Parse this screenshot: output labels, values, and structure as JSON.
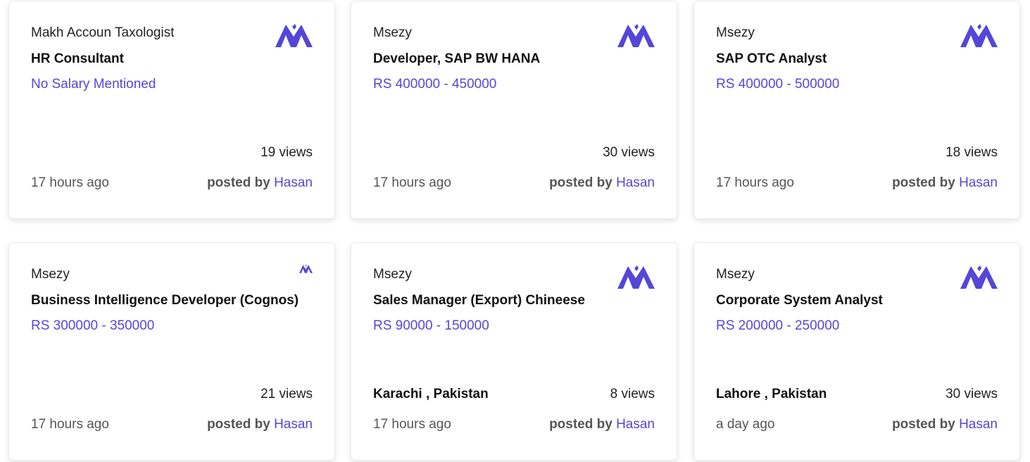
{
  "brand_color": "#5546d8",
  "logo_icon": "mountain-m-logo-icon",
  "cards": [
    {
      "company": "Makh Accoun Taxologist",
      "title": "HR Consultant",
      "salary": "No Salary Mentioned",
      "location": "",
      "views": "19 views",
      "time": "17 hours ago",
      "posted_label": "posted by",
      "poster": "Hasan"
    },
    {
      "company": "Msezy",
      "title": "Developer, SAP BW HANA",
      "salary": "RS 400000 - 450000",
      "location": "",
      "views": "30 views",
      "time": "17 hours ago",
      "posted_label": "posted by",
      "poster": "Hasan"
    },
    {
      "company": "Msezy",
      "title": "SAP OTC Analyst",
      "salary": "RS 400000 - 500000",
      "location": "",
      "views": "18 views",
      "time": "17 hours ago",
      "posted_label": "posted by",
      "poster": "Hasan"
    },
    {
      "company": "Msezy",
      "title": "Business Intelligence Developer (Cognos)",
      "salary": "RS 300000 - 350000",
      "location": "",
      "views": "21 views",
      "time": "17 hours ago",
      "posted_label": "posted by",
      "poster": "Hasan"
    },
    {
      "company": "Msezy",
      "title": "Sales Manager (Export) Chineese",
      "salary": "RS 90000 - 150000",
      "location": "Karachi , Pakistan",
      "views": "8 views",
      "time": "17 hours ago",
      "posted_label": "posted by",
      "poster": "Hasan"
    },
    {
      "company": "Msezy",
      "title": "Corporate System Analyst",
      "salary": "RS 200000 - 250000",
      "location": "Lahore , Pakistan",
      "views": "30 views",
      "time": "a day ago",
      "posted_label": "posted by",
      "poster": "Hasan"
    }
  ]
}
